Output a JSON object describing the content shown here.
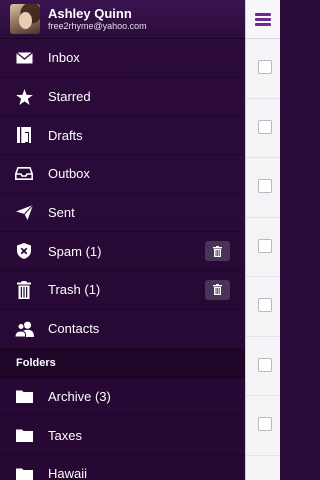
{
  "account": {
    "name": "Ashley Quinn",
    "email": "free2rhyme@yahoo.com"
  },
  "menu": [
    {
      "label": "Inbox",
      "icon": "envelope-icon"
    },
    {
      "label": "Starred",
      "icon": "star-icon"
    },
    {
      "label": "Drafts",
      "icon": "drafts-icon"
    },
    {
      "label": "Outbox",
      "icon": "outbox-tray-icon"
    },
    {
      "label": "Sent",
      "icon": "paper-plane-icon"
    },
    {
      "label": "Spam (1)",
      "icon": "spam-shield-icon"
    },
    {
      "label": "Trash (1)",
      "icon": "trash-icon"
    },
    {
      "label": "Contacts",
      "icon": "contacts-icon"
    }
  ],
  "folders": {
    "header": "Folders",
    "items": [
      {
        "label": "Archive (3)",
        "icon": "folder-icon"
      },
      {
        "label": "Taxes",
        "icon": "folder-icon"
      },
      {
        "label": "Hawaii",
        "icon": "folder-icon"
      }
    ]
  },
  "colors": {
    "drawer_bg": "#2c0b3c",
    "accent": "#6c2a96",
    "text": "#ffffff"
  }
}
